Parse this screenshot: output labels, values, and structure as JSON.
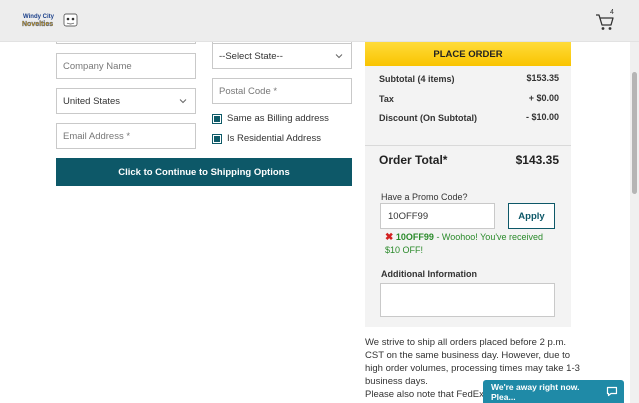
{
  "header": {
    "logo_line1": "Windy City",
    "logo_line2": "Novelties",
    "cart_count": "4"
  },
  "form": {
    "company_placeholder": "Company Name",
    "country_value": "United States",
    "email_placeholder": "Email Address *",
    "state_value": "--Select State--",
    "postal_placeholder": "Postal Code *",
    "same_as_billing_label": "Same as Billing address",
    "residential_label": "Is Residential Address",
    "continue_label": "Click to Continue to Shipping Options"
  },
  "summary": {
    "place_order_label": "PLACE ORDER",
    "subtotal_label": "Subtotal (4 items)",
    "subtotal_value": "$153.35",
    "tax_label": "Tax",
    "tax_value": "+ $0.00",
    "discount_label": "Discount (On Subtotal)",
    "discount_value": "- $10.00",
    "total_label": "Order Total*",
    "total_value": "$143.35",
    "promo_label": "Have a Promo Code?",
    "promo_value": "10OFF99",
    "apply_label": "Apply",
    "promo_msg_code": "10OFF99",
    "promo_msg_text": " - Woohoo! You've received $10 OFF!",
    "additional_label": "Additional Information"
  },
  "ship_note": {
    "line1": "We strive to ship all orders placed before 2 p.m. CST on the same business day. However, due to high order volumes, processing times may take 1-3 business days.",
    "line2": "Please also note that FedEx a"
  },
  "chat": {
    "label": "We're away right now. Plea..."
  },
  "colors": {
    "accent": "#0d5868",
    "place_order": "#f9c400",
    "chat": "#1f8aa7",
    "success": "#2a8a2a",
    "error": "#d32222"
  }
}
